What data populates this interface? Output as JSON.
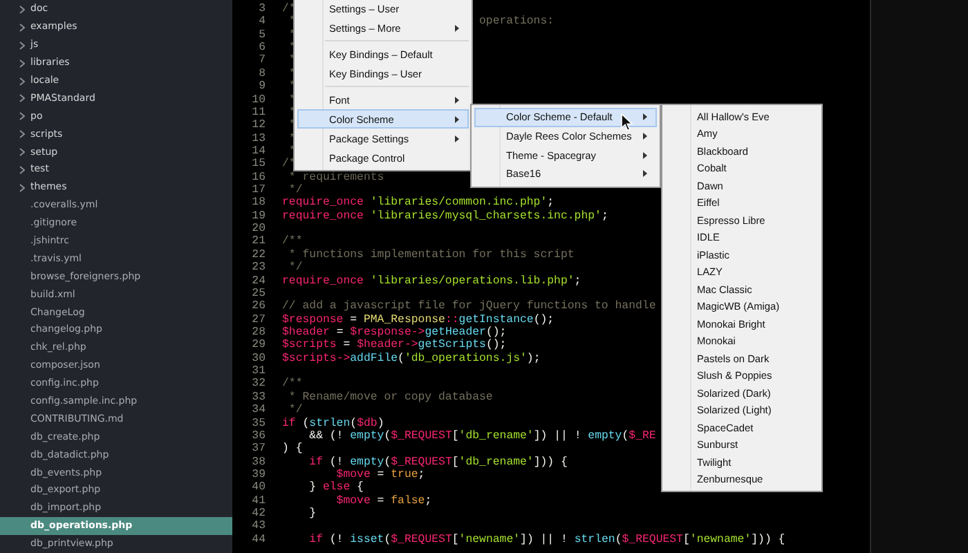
{
  "sidebar": {
    "items": [
      {
        "label": "doc",
        "kind": "folder",
        "selected": false
      },
      {
        "label": "examples",
        "kind": "folder",
        "selected": false
      },
      {
        "label": "js",
        "kind": "folder",
        "selected": false
      },
      {
        "label": "libraries",
        "kind": "folder",
        "selected": false
      },
      {
        "label": "locale",
        "kind": "folder",
        "selected": false
      },
      {
        "label": "PMAStandard",
        "kind": "folder",
        "selected": false
      },
      {
        "label": "po",
        "kind": "folder",
        "selected": false
      },
      {
        "label": "scripts",
        "kind": "folder",
        "selected": false
      },
      {
        "label": "setup",
        "kind": "folder",
        "selected": false
      },
      {
        "label": "test",
        "kind": "folder",
        "selected": false
      },
      {
        "label": "themes",
        "kind": "folder",
        "selected": false
      },
      {
        "label": ".coveralls.yml",
        "kind": "file",
        "selected": false
      },
      {
        "label": ".gitignore",
        "kind": "file",
        "selected": false
      },
      {
        "label": ".jshintrc",
        "kind": "file",
        "selected": false
      },
      {
        "label": ".travis.yml",
        "kind": "file",
        "selected": false
      },
      {
        "label": "browse_foreigners.php",
        "kind": "file",
        "selected": false
      },
      {
        "label": "build.xml",
        "kind": "file",
        "selected": false
      },
      {
        "label": "ChangeLog",
        "kind": "file",
        "selected": false
      },
      {
        "label": "changelog.php",
        "kind": "file",
        "selected": false
      },
      {
        "label": "chk_rel.php",
        "kind": "file",
        "selected": false
      },
      {
        "label": "composer.json",
        "kind": "file",
        "selected": false
      },
      {
        "label": "config.inc.php",
        "kind": "file",
        "selected": false
      },
      {
        "label": "config.sample.inc.php",
        "kind": "file",
        "selected": false
      },
      {
        "label": "CONTRIBUTING.md",
        "kind": "file",
        "selected": false
      },
      {
        "label": "db_create.php",
        "kind": "file",
        "selected": false
      },
      {
        "label": "db_datadict.php",
        "kind": "file",
        "selected": false
      },
      {
        "label": "db_events.php",
        "kind": "file",
        "selected": false
      },
      {
        "label": "db_export.php",
        "kind": "file",
        "selected": false
      },
      {
        "label": "db_import.php",
        "kind": "file",
        "selected": false
      },
      {
        "label": "db_operations.php",
        "kind": "file",
        "selected": true
      },
      {
        "label": "db_printview.php",
        "kind": "file",
        "selected": false
      }
    ]
  },
  "editor": {
    "lines": [
      {
        "number": "3",
        "tokens": [
          {
            "kind": "comment",
            "text": "/*"
          }
        ]
      },
      {
        "number": "4",
        "tokens": [
          {
            "kind": "comment",
            "text": " *"
          },
          {
            "kind": "comment",
            "text": "                           operations:"
          }
        ]
      },
      {
        "number": "5",
        "tokens": [
          {
            "kind": "comment",
            "text": " *"
          }
        ]
      },
      {
        "number": "6",
        "tokens": [
          {
            "kind": "comment",
            "text": " *"
          }
        ]
      },
      {
        "number": "7",
        "tokens": [
          {
            "kind": "comment",
            "text": " *"
          }
        ]
      },
      {
        "number": "8",
        "tokens": [
          {
            "kind": "comment",
            "text": " *"
          }
        ]
      },
      {
        "number": "9",
        "tokens": [
          {
            "kind": "comment",
            "text": " *"
          }
        ]
      },
      {
        "number": "10",
        "tokens": [
          {
            "kind": "comment",
            "text": " *"
          }
        ]
      },
      {
        "number": "11",
        "tokens": [
          {
            "kind": "comment",
            "text": " *"
          }
        ]
      },
      {
        "number": "12",
        "tokens": [
          {
            "kind": "comment",
            "text": " *"
          }
        ]
      },
      {
        "number": "13",
        "tokens": [
          {
            "kind": "comment",
            "text": " *"
          }
        ]
      },
      {
        "number": "14",
        "tokens": [
          {
            "kind": "comment",
            "text": " *"
          }
        ]
      },
      {
        "number": "15",
        "tokens": [
          {
            "kind": "comment",
            "text": "/*"
          }
        ]
      },
      {
        "number": "16",
        "tokens": [
          {
            "kind": "comment",
            "text": " * requirements"
          }
        ]
      },
      {
        "number": "17",
        "tokens": [
          {
            "kind": "comment",
            "text": " */"
          }
        ]
      },
      {
        "number": "18",
        "tokens": [
          {
            "kind": "keyword",
            "text": "require_once"
          },
          {
            "kind": "string",
            "text": " 'libraries/common.inc.php'"
          },
          {
            "kind": "plain",
            "text": ";"
          }
        ]
      },
      {
        "number": "19",
        "tokens": [
          {
            "kind": "keyword",
            "text": "require_once"
          },
          {
            "kind": "string",
            "text": " 'libraries/mysql_charsets.inc.php'"
          },
          {
            "kind": "plain",
            "text": ";"
          }
        ]
      },
      {
        "number": "20"
      },
      {
        "number": "21",
        "tokens": [
          {
            "kind": "comment",
            "text": "/**"
          }
        ]
      },
      {
        "number": "22",
        "tokens": [
          {
            "kind": "comment",
            "text": " * functions implementation for this script"
          }
        ]
      },
      {
        "number": "23",
        "tokens": [
          {
            "kind": "comment",
            "text": " */"
          }
        ]
      },
      {
        "number": "24",
        "tokens": [
          {
            "kind": "keyword",
            "text": "require_once"
          },
          {
            "kind": "string",
            "text": " 'libraries/operations.lib.php'"
          },
          {
            "kind": "plain",
            "text": ";"
          }
        ]
      },
      {
        "number": "25"
      },
      {
        "number": "26",
        "tokens": [
          {
            "kind": "comment",
            "text": "// add a javascript file for jQuery functions to handle"
          }
        ]
      },
      {
        "number": "27",
        "tokens": [
          {
            "kind": "variable",
            "text": "$response"
          },
          {
            "kind": "plain",
            "text": " = "
          },
          {
            "kind": "class",
            "text": "PMA_Response"
          },
          {
            "kind": "operator",
            "text": "::"
          },
          {
            "kind": "function",
            "text": "getInstance"
          },
          {
            "kind": "plain",
            "text": "();"
          }
        ]
      },
      {
        "number": "28",
        "tokens": [
          {
            "kind": "variable",
            "text": "$header"
          },
          {
            "kind": "plain",
            "text": " = "
          },
          {
            "kind": "variable",
            "text": "$response"
          },
          {
            "kind": "operator",
            "text": "->"
          },
          {
            "kind": "function",
            "text": "getHeader"
          },
          {
            "kind": "plain",
            "text": "();"
          }
        ]
      },
      {
        "number": "29",
        "tokens": [
          {
            "kind": "variable",
            "text": "$scripts"
          },
          {
            "kind": "plain",
            "text": " = "
          },
          {
            "kind": "variable",
            "text": "$header"
          },
          {
            "kind": "operator",
            "text": "->"
          },
          {
            "kind": "function",
            "text": "getScripts"
          },
          {
            "kind": "plain",
            "text": "();"
          }
        ]
      },
      {
        "number": "30",
        "tokens": [
          {
            "kind": "variable",
            "text": "$scripts"
          },
          {
            "kind": "operator",
            "text": "->"
          },
          {
            "kind": "function",
            "text": "addFile"
          },
          {
            "kind": "plain",
            "text": "("
          },
          {
            "kind": "string",
            "text": "'db_operations.js'"
          },
          {
            "kind": "plain",
            "text": ");"
          }
        ]
      },
      {
        "number": "31"
      },
      {
        "number": "32",
        "tokens": [
          {
            "kind": "comment",
            "text": "/**"
          }
        ]
      },
      {
        "number": "33",
        "tokens": [
          {
            "kind": "comment",
            "text": " * Rename/move or copy database"
          }
        ]
      },
      {
        "number": "34",
        "tokens": [
          {
            "kind": "comment",
            "text": " */"
          }
        ]
      },
      {
        "number": "35",
        "tokens": [
          {
            "kind": "keyword",
            "text": "if"
          },
          {
            "kind": "plain",
            "text": " ("
          },
          {
            "kind": "function",
            "text": "strlen"
          },
          {
            "kind": "plain",
            "text": "("
          },
          {
            "kind": "variable",
            "text": "$db"
          },
          {
            "kind": "plain",
            "text": ")"
          }
        ]
      },
      {
        "number": "36",
        "tokens": [
          {
            "kind": "plain",
            "text": "    && (! "
          },
          {
            "kind": "function",
            "text": "empty"
          },
          {
            "kind": "plain",
            "text": "("
          },
          {
            "kind": "variable",
            "text": "$_REQUEST"
          },
          {
            "kind": "plain",
            "text": "["
          },
          {
            "kind": "string",
            "text": "'db_rename'"
          },
          {
            "kind": "plain",
            "text": "]) || ! "
          },
          {
            "kind": "function",
            "text": "empty"
          },
          {
            "kind": "plain",
            "text": "("
          },
          {
            "kind": "variable",
            "text": "$_RE"
          }
        ]
      },
      {
        "number": "37",
        "tokens": [
          {
            "kind": "plain",
            "text": ") {"
          }
        ]
      },
      {
        "number": "38",
        "tokens": [
          {
            "kind": "keyword",
            "text": "    if"
          },
          {
            "kind": "plain",
            "text": " (! "
          },
          {
            "kind": "function",
            "text": "empty"
          },
          {
            "kind": "plain",
            "text": "("
          },
          {
            "kind": "variable",
            "text": "$_REQUEST"
          },
          {
            "kind": "plain",
            "text": "["
          },
          {
            "kind": "string",
            "text": "'db_rename'"
          },
          {
            "kind": "plain",
            "text": "])) {"
          }
        ]
      },
      {
        "number": "39",
        "tokens": [
          {
            "kind": "variable",
            "text": "        $move"
          },
          {
            "kind": "plain",
            "text": " = "
          },
          {
            "kind": "constant",
            "text": "true"
          },
          {
            "kind": "plain",
            "text": ";"
          }
        ]
      },
      {
        "number": "40",
        "tokens": [
          {
            "kind": "plain",
            "text": "    } "
          },
          {
            "kind": "keyword",
            "text": "else"
          },
          {
            "kind": "plain",
            "text": " {"
          }
        ]
      },
      {
        "number": "41",
        "tokens": [
          {
            "kind": "variable",
            "text": "        $move"
          },
          {
            "kind": "plain",
            "text": " = "
          },
          {
            "kind": "constant",
            "text": "false"
          },
          {
            "kind": "plain",
            "text": ";"
          }
        ]
      },
      {
        "number": "42",
        "tokens": [
          {
            "kind": "plain",
            "text": "    }"
          }
        ]
      },
      {
        "number": "43"
      },
      {
        "number": "44",
        "tokens": [
          {
            "kind": "keyword",
            "text": "    if"
          },
          {
            "kind": "plain",
            "text": " (! "
          },
          {
            "kind": "function",
            "text": "isset"
          },
          {
            "kind": "plain",
            "text": "("
          },
          {
            "kind": "variable",
            "text": "$_REQUEST"
          },
          {
            "kind": "plain",
            "text": "["
          },
          {
            "kind": "string",
            "text": "'newname'"
          },
          {
            "kind": "plain",
            "text": "]) || ! "
          },
          {
            "kind": "function",
            "text": "strlen"
          },
          {
            "kind": "plain",
            "text": "("
          },
          {
            "kind": "variable",
            "text": "$_REQUEST"
          },
          {
            "kind": "plain",
            "text": "["
          },
          {
            "kind": "string",
            "text": "'newname'"
          },
          {
            "kind": "plain",
            "text": "])) {"
          }
        ]
      }
    ]
  },
  "menus": [
    {
      "items": [
        {
          "kind": "item",
          "label": "Settings – User",
          "has_submenu": false,
          "selected": false
        },
        {
          "kind": "item",
          "label": "Settings – More",
          "has_submenu": true,
          "selected": false
        },
        {
          "kind": "separator"
        },
        {
          "kind": "item",
          "label": "Key Bindings – Default",
          "has_submenu": false,
          "selected": false
        },
        {
          "kind": "item",
          "label": "Key Bindings – User",
          "has_submenu": false,
          "selected": false
        },
        {
          "kind": "separator"
        },
        {
          "kind": "item",
          "label": "Font",
          "has_submenu": true,
          "selected": false
        },
        {
          "kind": "item",
          "label": "Color Scheme",
          "has_submenu": true,
          "selected": true
        },
        {
          "kind": "item",
          "label": "Package Settings",
          "has_submenu": true,
          "selected": false
        },
        {
          "kind": "item",
          "label": "Package Control",
          "has_submenu": false,
          "selected": false
        }
      ]
    },
    {
      "items": [
        {
          "kind": "item",
          "label": "Color Scheme - Default",
          "has_submenu": true,
          "selected": true
        },
        {
          "kind": "item",
          "label": "Dayle Rees Color Schemes",
          "has_submenu": true,
          "selected": false
        },
        {
          "kind": "item",
          "label": "Theme - Spacegray",
          "has_submenu": true,
          "selected": false
        },
        {
          "kind": "item",
          "label": "Base16",
          "has_submenu": true,
          "selected": false
        }
      ]
    },
    {
      "items": [
        {
          "kind": "item",
          "label": "All Hallow's Eve",
          "has_submenu": false,
          "selected": false
        },
        {
          "kind": "item",
          "label": "Amy",
          "has_submenu": false,
          "selected": false
        },
        {
          "kind": "item",
          "label": "Blackboard",
          "has_submenu": false,
          "selected": false
        },
        {
          "kind": "item",
          "label": "Cobalt",
          "has_submenu": false,
          "selected": false
        },
        {
          "kind": "item",
          "label": "Dawn",
          "has_submenu": false,
          "selected": false
        },
        {
          "kind": "item",
          "label": "Eiffel",
          "has_submenu": false,
          "selected": false
        },
        {
          "kind": "item",
          "label": "Espresso Libre",
          "has_submenu": false,
          "selected": false
        },
        {
          "kind": "item",
          "label": "IDLE",
          "has_submenu": false,
          "selected": false
        },
        {
          "kind": "item",
          "label": "iPlastic",
          "has_submenu": false,
          "selected": false
        },
        {
          "kind": "item",
          "label": "LAZY",
          "has_submenu": false,
          "selected": false
        },
        {
          "kind": "item",
          "label": "Mac Classic",
          "has_submenu": false,
          "selected": false
        },
        {
          "kind": "item",
          "label": "MagicWB (Amiga)",
          "has_submenu": false,
          "selected": false
        },
        {
          "kind": "item",
          "label": "Monokai Bright",
          "has_submenu": false,
          "selected": false
        },
        {
          "kind": "item",
          "label": "Monokai",
          "has_submenu": false,
          "selected": false
        },
        {
          "kind": "item",
          "label": "Pastels on Dark",
          "has_submenu": false,
          "selected": false
        },
        {
          "kind": "item",
          "label": "Slush & Poppies",
          "has_submenu": false,
          "selected": false
        },
        {
          "kind": "item",
          "label": "Solarized (Dark)",
          "has_submenu": false,
          "selected": false
        },
        {
          "kind": "item",
          "label": "Solarized (Light)",
          "has_submenu": false,
          "selected": false
        },
        {
          "kind": "item",
          "label": "SpaceCadet",
          "has_submenu": false,
          "selected": false
        },
        {
          "kind": "item",
          "label": "Sunburst",
          "has_submenu": false,
          "selected": false
        },
        {
          "kind": "item",
          "label": "Twilight",
          "has_submenu": false,
          "selected": false
        },
        {
          "kind": "item",
          "label": "Zenburnesque",
          "has_submenu": false,
          "selected": false
        }
      ]
    }
  ]
}
